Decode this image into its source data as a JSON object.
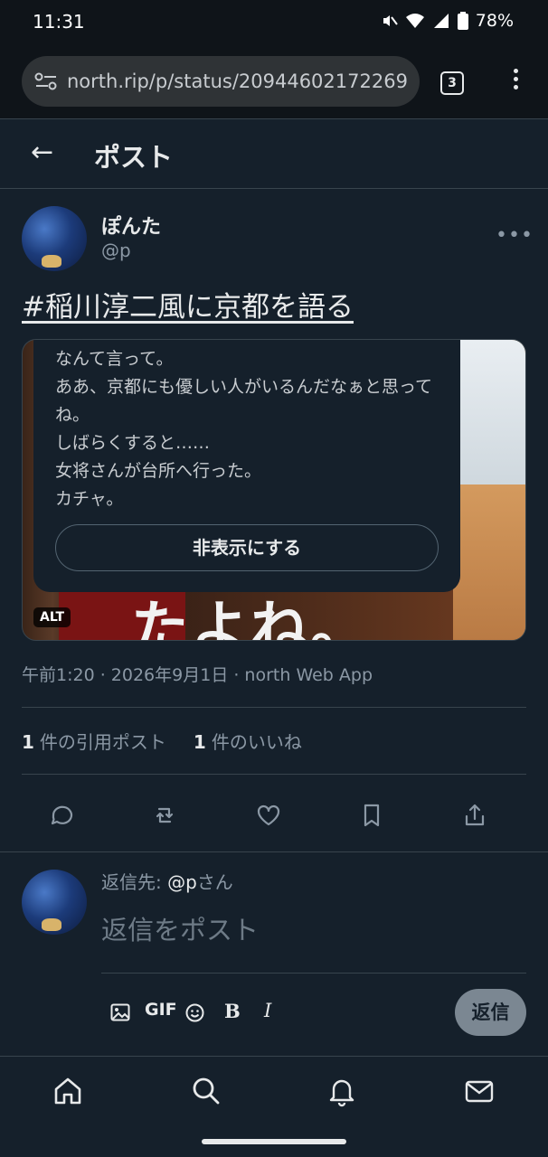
{
  "status_bar": {
    "time": "11:31",
    "battery": "78%",
    "icons": [
      "mute-icon",
      "wifi-icon",
      "signal-icon",
      "battery-icon"
    ]
  },
  "browser": {
    "url": "north.rip/p/status/20944602172269",
    "tab_count": "3"
  },
  "header": {
    "title": "ポスト"
  },
  "post": {
    "display_name": "ぽんた",
    "handle": "@p",
    "hashtag": "#稲川淳二風に京都を語る",
    "alt_text": "なんて言って。\nああ、京都にも優しい人がいるんだなぁと思ってね。\nしばらくすると……\n女将さんが台所へ行った。\nカチャ。",
    "hide_label": "非表示にする",
    "alt_badge": "ALT",
    "image_caption_fragment": "たよね。",
    "timestamp": "午前1:20 · 2026年9月1日 · north Web App",
    "quotes_count": "1",
    "quotes_label": "件の引用ポスト",
    "likes_count": "1",
    "likes_label": "件のいいね"
  },
  "reply": {
    "reply_to_prefix": "返信先: ",
    "reply_to_handle": "@p",
    "reply_to_suffix": "さん",
    "placeholder": "返信をポスト",
    "gif_label": "GIF",
    "bold_label": "B",
    "italic_label": "I",
    "submit_label": "返信"
  },
  "colors": {
    "background": "#15202b",
    "text": "#e7e9ea",
    "muted": "#8b98a5",
    "border": "#38444d"
  }
}
